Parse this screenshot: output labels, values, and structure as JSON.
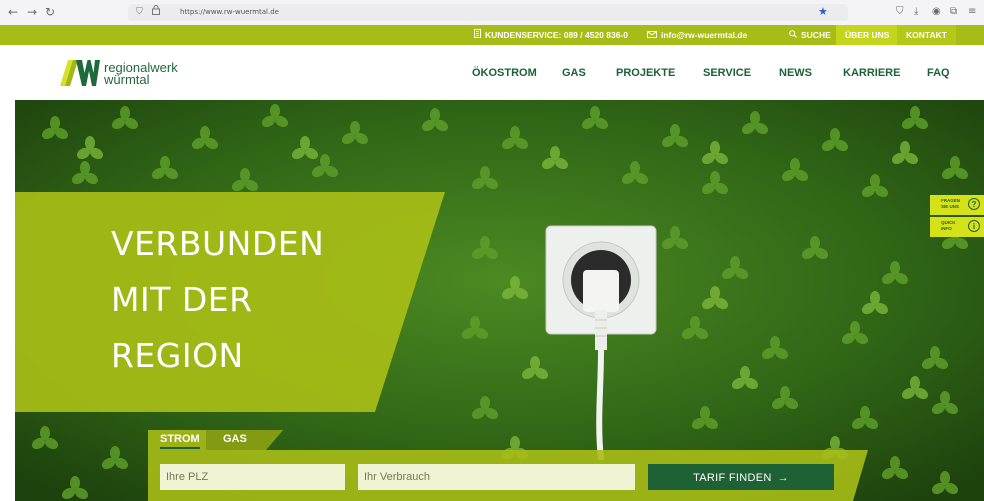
{
  "browser": {
    "url": "https://www.rw-wuermtal.de"
  },
  "topbar": {
    "kundenservice": "KUNDENSERVICE: 089 / 4520 836-0",
    "email": "info@rw-wuermtal.de",
    "suche": "SUCHE",
    "ueber_uns": "ÜBER UNS",
    "kontakt": "KONTAKT"
  },
  "logo": {
    "line1": "regionalwerk",
    "line2": "würmtal"
  },
  "nav": {
    "items": [
      "ÖKOSTROM",
      "GAS",
      "PROJEKTE",
      "SERVICE",
      "NEWS",
      "KARRIERE",
      "FAQ"
    ]
  },
  "hero": {
    "lines": [
      "VERBUNDEN",
      "MIT DER",
      "REGION"
    ]
  },
  "side_tabs": [
    {
      "line1": "FRAGEN",
      "line2": "SIE UNS",
      "icon": "?"
    },
    {
      "line1": "QUICK",
      "line2": "INFO",
      "icon": "i"
    }
  ],
  "tariff": {
    "tab_strom": "STROM",
    "tab_gas": "GAS",
    "plz_placeholder": "Ihre PLZ",
    "verbrauch_placeholder": "Ihr Verbrauch",
    "button_label": "TARIF FINDEN"
  },
  "colors": {
    "brand_green": "#a7bd17",
    "dark_green": "#1c6235",
    "side_yellow": "#d5e21a"
  }
}
